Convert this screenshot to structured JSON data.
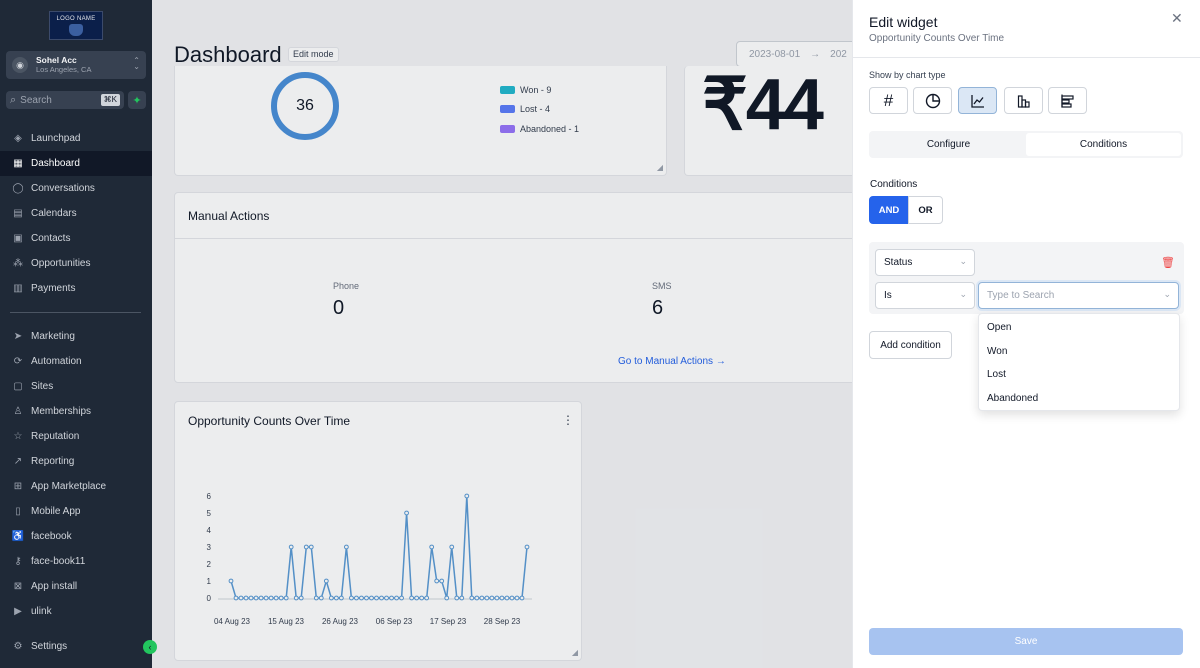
{
  "sidebar": {
    "logo_text": "LOGO NAME",
    "account": {
      "name": "Sohel Acc",
      "location": "Los Angeles, CA"
    },
    "search": {
      "placeholder": "Search",
      "shortcut": "⌘K"
    },
    "items": [
      {
        "label": "Launchpad",
        "icon": "rocket-icon",
        "active": false
      },
      {
        "label": "Dashboard",
        "icon": "grid-icon",
        "active": true
      },
      {
        "label": "Conversations",
        "icon": "chat-icon",
        "active": false
      },
      {
        "label": "Calendars",
        "icon": "calendar-icon",
        "active": false
      },
      {
        "label": "Contacts",
        "icon": "contacts-icon",
        "active": false
      },
      {
        "label": "Opportunities",
        "icon": "opportunities-icon",
        "active": false
      },
      {
        "label": "Payments",
        "icon": "payments-icon",
        "active": false
      },
      {
        "label": "Marketing",
        "icon": "send-icon",
        "active": false
      },
      {
        "label": "Automation",
        "icon": "automation-icon",
        "active": false
      },
      {
        "label": "Sites",
        "icon": "sites-icon",
        "active": false
      },
      {
        "label": "Memberships",
        "icon": "memberships-icon",
        "active": false
      },
      {
        "label": "Reputation",
        "icon": "star-icon",
        "active": false
      },
      {
        "label": "Reporting",
        "icon": "trend-icon",
        "active": false
      },
      {
        "label": "App Marketplace",
        "icon": "apps-icon",
        "active": false
      },
      {
        "label": "Mobile App",
        "icon": "mobile-icon",
        "active": false
      },
      {
        "label": "facebook",
        "icon": "accessibility-icon",
        "active": false
      },
      {
        "label": "face-book11",
        "icon": "key-icon",
        "active": false
      },
      {
        "label": "App install",
        "icon": "close-box-icon",
        "active": false
      },
      {
        "label": "ulink",
        "icon": "video-icon",
        "active": false
      }
    ],
    "settings_label": "Settings"
  },
  "main": {
    "title": "Dashboard",
    "edit_badge": "Edit mode",
    "date_start": "2023-08-01",
    "date_arrow": "→",
    "date_end_partial": "202",
    "status_widget": {
      "total": "36",
      "legend": [
        {
          "label": "Won - 9",
          "color": "#22b8cf"
        },
        {
          "label": "Lost - 4",
          "color": "#5c7cfa"
        },
        {
          "label": "Abandoned - 1",
          "color": "#9775fa"
        }
      ],
      "ring_color": "#4a90d9"
    },
    "revenue_partial": "₹44",
    "manual_actions": {
      "title": "Manual Actions",
      "stats": [
        {
          "label": "Phone",
          "value": "0"
        },
        {
          "label": "SMS",
          "value": "6"
        }
      ],
      "link": "Go to Manual Actions →"
    },
    "opportunity_widget": {
      "title": "Opportunity Counts Over Time"
    }
  },
  "chart_data": {
    "type": "line",
    "title": "Opportunity Counts Over Time",
    "x_ticks": [
      "04 Aug 23",
      "15 Aug 23",
      "26 Aug 23",
      "06 Sep 23",
      "17 Sep 23",
      "28 Sep 23"
    ],
    "y_ticks": [
      "0",
      "1",
      "2",
      "3",
      "4",
      "5",
      "6"
    ],
    "ylim": [
      0,
      6
    ],
    "color": "#5b9bd5",
    "series": [
      {
        "values": [
          1,
          0,
          0,
          0,
          0,
          0,
          0,
          0,
          0,
          0,
          0,
          0,
          3,
          0,
          0,
          3,
          3,
          0,
          0,
          1,
          0,
          0,
          0,
          3,
          0,
          0,
          0,
          0,
          0,
          0,
          0,
          0,
          0,
          0,
          0,
          5,
          0,
          0,
          0,
          0,
          3,
          1,
          1,
          0,
          3,
          0,
          0,
          6,
          0,
          0,
          0,
          0,
          0,
          0,
          0,
          0,
          0,
          0,
          0,
          3
        ]
      }
    ]
  },
  "panel": {
    "title": "Edit widget",
    "subtitle": "Opportunity Counts Over Time",
    "close_icon": "close-icon",
    "chart_type_label": "Show by chart type",
    "chart_types": [
      {
        "icon": "number-icon",
        "glyph": "#",
        "active": false
      },
      {
        "icon": "pie-chart-icon",
        "glyph": "◔",
        "active": false
      },
      {
        "icon": "line-chart-icon",
        "glyph": "📈",
        "active": true
      },
      {
        "icon": "bar-chart-icon",
        "glyph": "▥",
        "active": false
      },
      {
        "icon": "horizontal-bar-icon",
        "glyph": "☰",
        "active": false
      }
    ],
    "tabs": [
      {
        "label": "Configure",
        "active": false
      },
      {
        "label": "Conditions",
        "active": true
      }
    ],
    "conditions_label": "Conditions",
    "and_label": "AND",
    "or_label": "OR",
    "condition": {
      "field": "Status",
      "operator": "Is",
      "value_placeholder": "Type to Search"
    },
    "dropdown_options": [
      "Open",
      "Won",
      "Lost",
      "Abandoned"
    ],
    "add_condition_label": "Add condition",
    "save_label": "Save"
  }
}
